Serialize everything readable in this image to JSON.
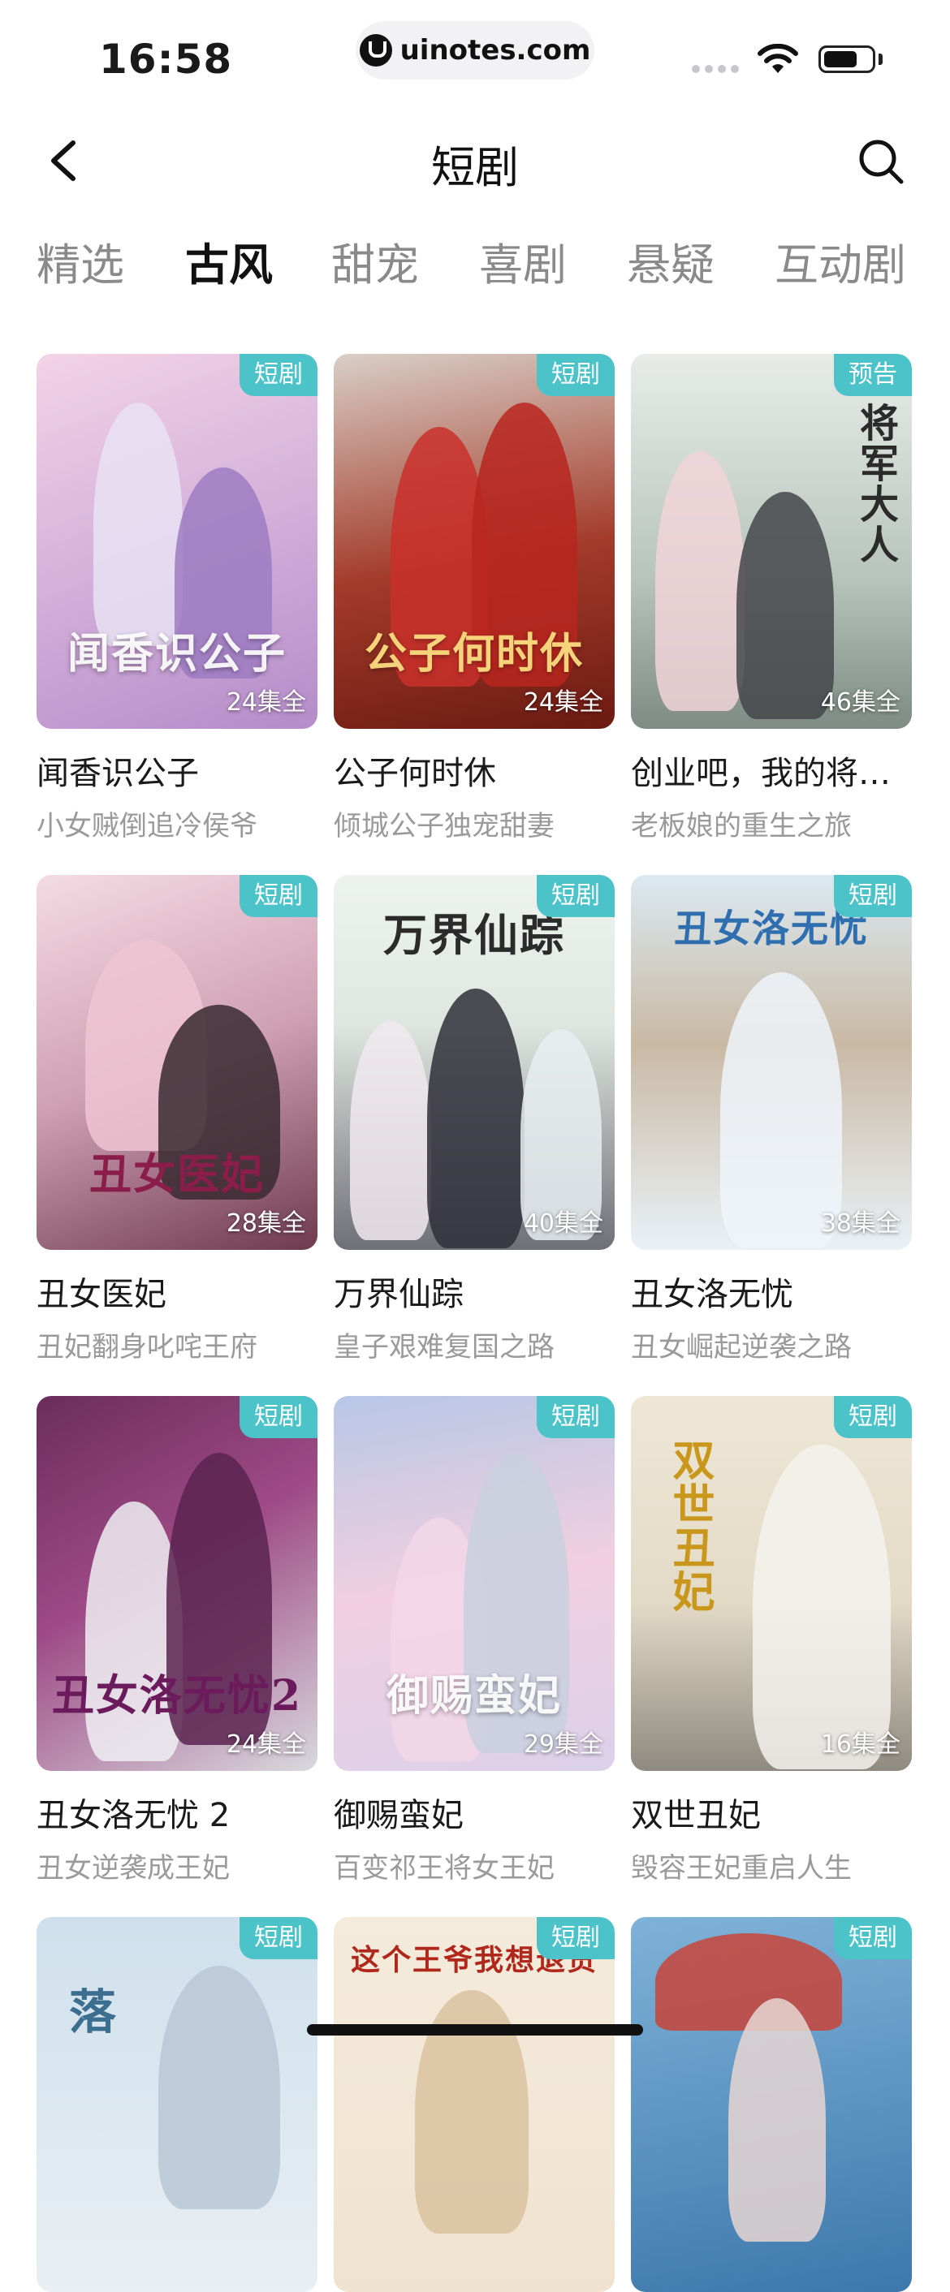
{
  "status_bar": {
    "time": "16:58",
    "url": "uinotes.com"
  },
  "nav": {
    "title": "短剧",
    "back_icon": "chevron-left-icon",
    "search_icon": "search-icon"
  },
  "tabs": [
    {
      "label": "精选",
      "active": false
    },
    {
      "label": "古风",
      "active": true
    },
    {
      "label": "甜宠",
      "active": false
    },
    {
      "label": "喜剧",
      "active": false
    },
    {
      "label": "悬疑",
      "active": false
    },
    {
      "label": "互动剧",
      "active": false
    }
  ],
  "colors": {
    "badge": "#4cc3c9",
    "text_primary": "#1a1a1a",
    "text_secondary": "#9a9a9a",
    "tab_inactive": "#8a8a8a"
  },
  "cards": [
    {
      "badge": "短剧",
      "episodes": "24集全",
      "title": "闻香识公子",
      "subtitle": "小女贼倒追冷侯爷",
      "art": "闻香识公子"
    },
    {
      "badge": "短剧",
      "episodes": "24集全",
      "title": "公子何时休",
      "subtitle": "倾城公子独宠甜妻",
      "art": "公子何时休"
    },
    {
      "badge": "预告",
      "episodes": "46集全",
      "title": "创业吧，我的将…",
      "subtitle": "老板娘的重生之旅",
      "art": "将军大人"
    },
    {
      "badge": "短剧",
      "episodes": "28集全",
      "title": "丑女医妃",
      "subtitle": "丑妃翻身叱咤王府",
      "art": "丑女医妃"
    },
    {
      "badge": "短剧",
      "episodes": "40集全",
      "title": "万界仙踪",
      "subtitle": "皇子艰难复国之路",
      "art": "万界仙踪"
    },
    {
      "badge": "短剧",
      "episodes": "38集全",
      "title": "丑女洛无忧",
      "subtitle": "丑女崛起逆袭之路",
      "art": "丑女洛无忧"
    },
    {
      "badge": "短剧",
      "episodes": "24集全",
      "title": "丑女洛无忧 2",
      "subtitle": "丑女逆袭成王妃",
      "art": "丑女洛无忧2"
    },
    {
      "badge": "短剧",
      "episodes": "29集全",
      "title": "御赐蛮妃",
      "subtitle": "百变祁王将女王妃",
      "art": "御赐蛮妃"
    },
    {
      "badge": "短剧",
      "episodes": "16集全",
      "title": "双世丑妃",
      "subtitle": "毁容王妃重启人生",
      "art": "双世丑妃"
    },
    {
      "badge": "短剧",
      "episodes": "",
      "title": "",
      "subtitle": "",
      "art": "落"
    },
    {
      "badge": "短剧",
      "episodes": "",
      "title": "",
      "subtitle": "",
      "art": "这个王爷我想退货"
    },
    {
      "badge": "短剧",
      "episodes": "",
      "title": "",
      "subtitle": "",
      "art": ""
    }
  ]
}
